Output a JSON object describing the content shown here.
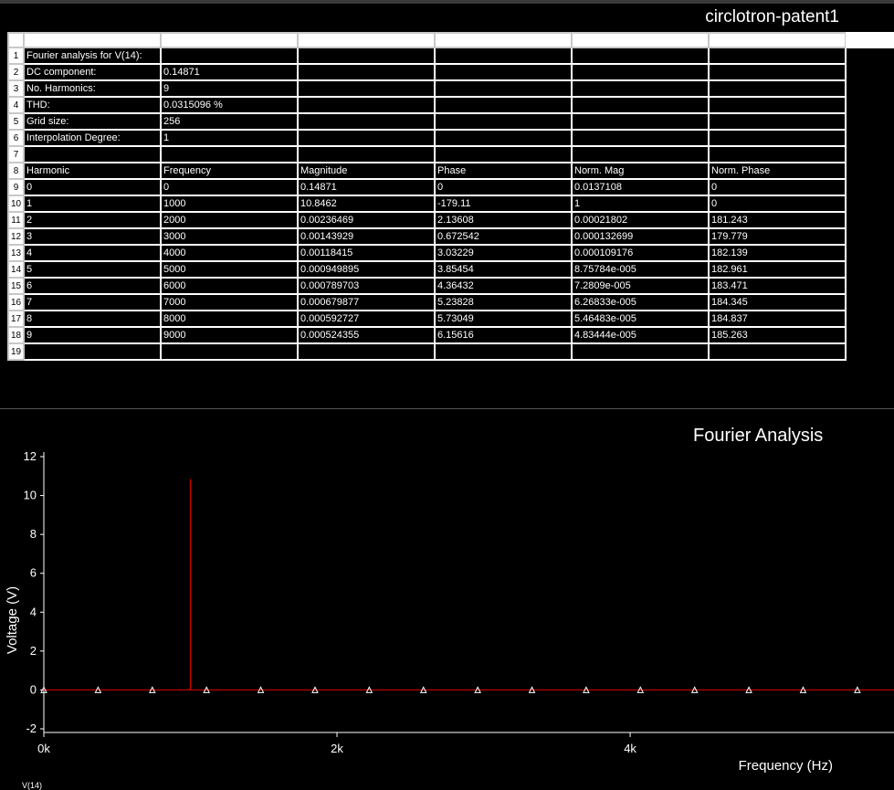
{
  "window": {
    "title": "circlotron-patent1"
  },
  "grid": {
    "rows": [
      [
        "Fourier analysis for V(14):",
        "",
        "",
        "",
        "",
        ""
      ],
      [
        "DC component:",
        "0.14871",
        "",
        "",
        "",
        ""
      ],
      [
        "No. Harmonics:",
        "9",
        "",
        "",
        "",
        ""
      ],
      [
        "THD:",
        "0.0315096 %",
        "",
        "",
        "",
        ""
      ],
      [
        "Grid size:",
        "256",
        "",
        "",
        "",
        ""
      ],
      [
        "Interpolation Degree:",
        "1",
        "",
        "",
        "",
        ""
      ],
      [
        "",
        "",
        "",
        "",
        "",
        ""
      ],
      [
        "Harmonic",
        "Frequency",
        "Magnitude",
        "Phase",
        "Norm. Mag",
        "Norm. Phase"
      ],
      [
        "0",
        "0",
        "0.14871",
        "0",
        "0.0137108",
        "0"
      ],
      [
        "1",
        "1000",
        "10.8462",
        "-179.11",
        "1",
        "0"
      ],
      [
        "2",
        "2000",
        "0.00236469",
        "2.13608",
        "0.00021802",
        "181.243"
      ],
      [
        "3",
        "3000",
        "0.00143929",
        "0.672542",
        "0.000132699",
        "179.779"
      ],
      [
        "4",
        "4000",
        "0.00118415",
        "3.03229",
        "0.000109176",
        "182.139"
      ],
      [
        "5",
        "5000",
        "0.000949895",
        "3.85454",
        "8.75784e-005",
        "182.961"
      ],
      [
        "6",
        "6000",
        "0.000789703",
        "4.36432",
        "7.2809e-005",
        "183.471"
      ],
      [
        "7",
        "7000",
        "0.000679877",
        "5.23828",
        "6.26833e-005",
        "184.345"
      ],
      [
        "8",
        "8000",
        "0.000592727",
        "5.73049",
        "5.46483e-005",
        "184.837"
      ],
      [
        "9",
        "9000",
        "0.000524355",
        "6.15616",
        "4.83444e-005",
        "185.263"
      ],
      [
        "",
        "",
        "",
        "",
        "",
        ""
      ]
    ]
  },
  "colors": {
    "trace": "#cc0000",
    "background": "#000000",
    "foreground": "#ffffff"
  },
  "chart_data": {
    "type": "bar",
    "title": "Fourier Analysis",
    "xlabel": "Frequency (Hz)",
    "ylabel": "Voltage (V)",
    "xlim": [
      0,
      5800
    ],
    "ylim": [
      -2,
      12
    ],
    "x_ticks": [
      0,
      2000,
      4000
    ],
    "x_tick_labels": [
      "0k",
      "2k",
      "4k"
    ],
    "y_ticks": [
      -2,
      0,
      2,
      4,
      6,
      8,
      10,
      12
    ],
    "series": [
      {
        "name": "V(14)",
        "x": [
          0,
          1000,
          2000,
          3000,
          4000,
          5000,
          6000,
          7000,
          8000,
          9000
        ],
        "values": [
          0.14871,
          10.8462,
          0.00236469,
          0.00143929,
          0.00118415,
          0.000949895,
          0.000789703,
          0.000679877,
          0.000592727,
          0.000524355
        ]
      }
    ],
    "marker_x": [
      0,
      370,
      740,
      1110,
      1480,
      1850,
      2220,
      2590,
      2960,
      3330,
      3700,
      4070,
      4440,
      4810,
      5180,
      5550
    ],
    "marker_y": 0,
    "grid": false,
    "legend_position": "bottom-left"
  }
}
